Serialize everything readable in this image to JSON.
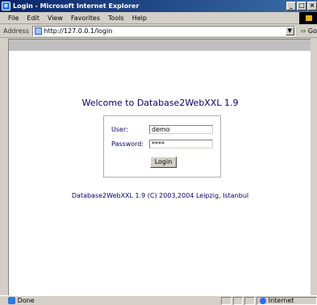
{
  "window": {
    "title": "Login - Microsoft Internet Explorer",
    "buttons": [
      "_",
      "□",
      "×"
    ]
  },
  "menu": {
    "items": [
      "File",
      "Edit",
      "View",
      "Favorites",
      "Tools",
      "Help"
    ]
  },
  "address": {
    "label": "Address",
    "url": "http://127.0.0.1/login",
    "go_label": "Go"
  },
  "page": {
    "heading": "Welcome to Database2WebXXL 1.9",
    "form": {
      "user_label": "User:",
      "user_value": "demo",
      "password_label": "Password:",
      "password_value": "****",
      "submit_label": "Login"
    },
    "footer": "Database2WebXXL 1.9 (C) 2003,2004 Leipzig, Istanbul"
  },
  "status": {
    "text": "Done",
    "zone": "Internet"
  }
}
